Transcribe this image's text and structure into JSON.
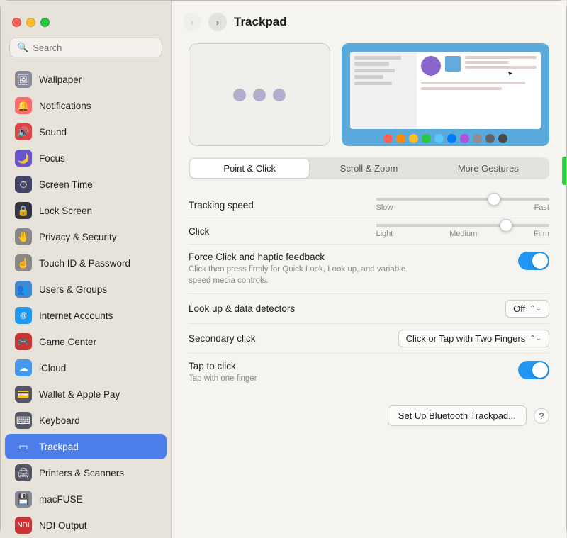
{
  "window": {
    "title": "Trackpad"
  },
  "sidebar": {
    "search_placeholder": "Search",
    "items": [
      {
        "id": "wallpaper",
        "label": "Wallpaper",
        "icon": "🖼",
        "icon_bg": "#888",
        "active": false
      },
      {
        "id": "notifications",
        "label": "Notifications",
        "icon": "🔔",
        "icon_bg": "#ff6b6b",
        "active": false
      },
      {
        "id": "sound",
        "label": "Sound",
        "icon": "🔊",
        "icon_bg": "#ff6b6b",
        "active": false
      },
      {
        "id": "focus",
        "label": "Focus",
        "icon": "🌙",
        "icon_bg": "#6655cc",
        "active": false
      },
      {
        "id": "screen-time",
        "label": "Screen Time",
        "icon": "⏱",
        "icon_bg": "#555577",
        "active": false
      },
      {
        "id": "lock-screen",
        "label": "Lock Screen",
        "icon": "🔒",
        "icon_bg": "#333",
        "active": false
      },
      {
        "id": "privacy-security",
        "label": "Privacy & Security",
        "icon": "🤚",
        "icon_bg": "#888",
        "active": false
      },
      {
        "id": "touch-id",
        "label": "Touch ID & Password",
        "icon": "☝",
        "icon_bg": "#888",
        "active": false
      },
      {
        "id": "users-groups",
        "label": "Users & Groups",
        "icon": "👥",
        "icon_bg": "#4488cc",
        "active": false
      },
      {
        "id": "internet-accounts",
        "label": "Internet Accounts",
        "icon": "@",
        "icon_bg": "#4488cc",
        "active": false
      },
      {
        "id": "game-center",
        "label": "Game Center",
        "icon": "🎮",
        "icon_bg": "#cc3333",
        "active": false
      },
      {
        "id": "icloud",
        "label": "iCloud",
        "icon": "☁",
        "icon_bg": "#4499ee",
        "active": false
      },
      {
        "id": "wallet",
        "label": "Wallet & Apple Pay",
        "icon": "🗓",
        "icon_bg": "#555",
        "active": false
      },
      {
        "id": "keyboard",
        "label": "Keyboard",
        "icon": "⌨",
        "icon_bg": "#555",
        "active": false
      },
      {
        "id": "trackpad",
        "label": "Trackpad",
        "icon": "⬜",
        "icon_bg": "#4d7de8",
        "active": true
      },
      {
        "id": "printers",
        "label": "Printers & Scanners",
        "icon": "🖨",
        "icon_bg": "#555",
        "active": false
      },
      {
        "id": "macfuse",
        "label": "macFUSE",
        "icon": "💾",
        "icon_bg": "#888",
        "active": false
      },
      {
        "id": "ndi",
        "label": "NDI Output",
        "icon": "N",
        "icon_bg": "#cc3333",
        "active": false
      }
    ]
  },
  "main": {
    "title": "Trackpad",
    "tabs": [
      {
        "id": "point-click",
        "label": "Point & Click",
        "active": true
      },
      {
        "id": "scroll-zoom",
        "label": "Scroll & Zoom",
        "active": false
      },
      {
        "id": "more-gestures",
        "label": "More Gestures",
        "active": false
      }
    ],
    "settings": {
      "tracking_speed": {
        "label": "Tracking speed",
        "slow_label": "Slow",
        "fast_label": "Fast",
        "value_pct": 68
      },
      "click": {
        "label": "Click",
        "light_label": "Light",
        "medium_label": "Medium",
        "firm_label": "Firm",
        "value_pct": 75
      },
      "force_click": {
        "label": "Force Click and haptic feedback",
        "sublabel": "Click then press firmly for Quick Look, Look up, and variable speed media controls.",
        "enabled": true
      },
      "lookup": {
        "label": "Look up & data detectors",
        "value": "Off",
        "type": "dropdown"
      },
      "secondary_click": {
        "label": "Secondary click",
        "value": "Click or Tap with Two Fingers",
        "type": "dropdown"
      },
      "tap_to_click": {
        "label": "Tap to click",
        "sublabel": "Tap with one finger",
        "enabled": true
      }
    },
    "buttons": {
      "setup_bluetooth": "Set Up Bluetooth Trackpad...",
      "help": "?"
    }
  },
  "colors": {
    "swatches": [
      "#ff5f57",
      "#ff8c00",
      "#ffbd2e",
      "#28c840",
      "#5ac8fa",
      "#007aff",
      "#af52de",
      "#8e8e93",
      "#636366",
      "#48484a"
    ]
  }
}
